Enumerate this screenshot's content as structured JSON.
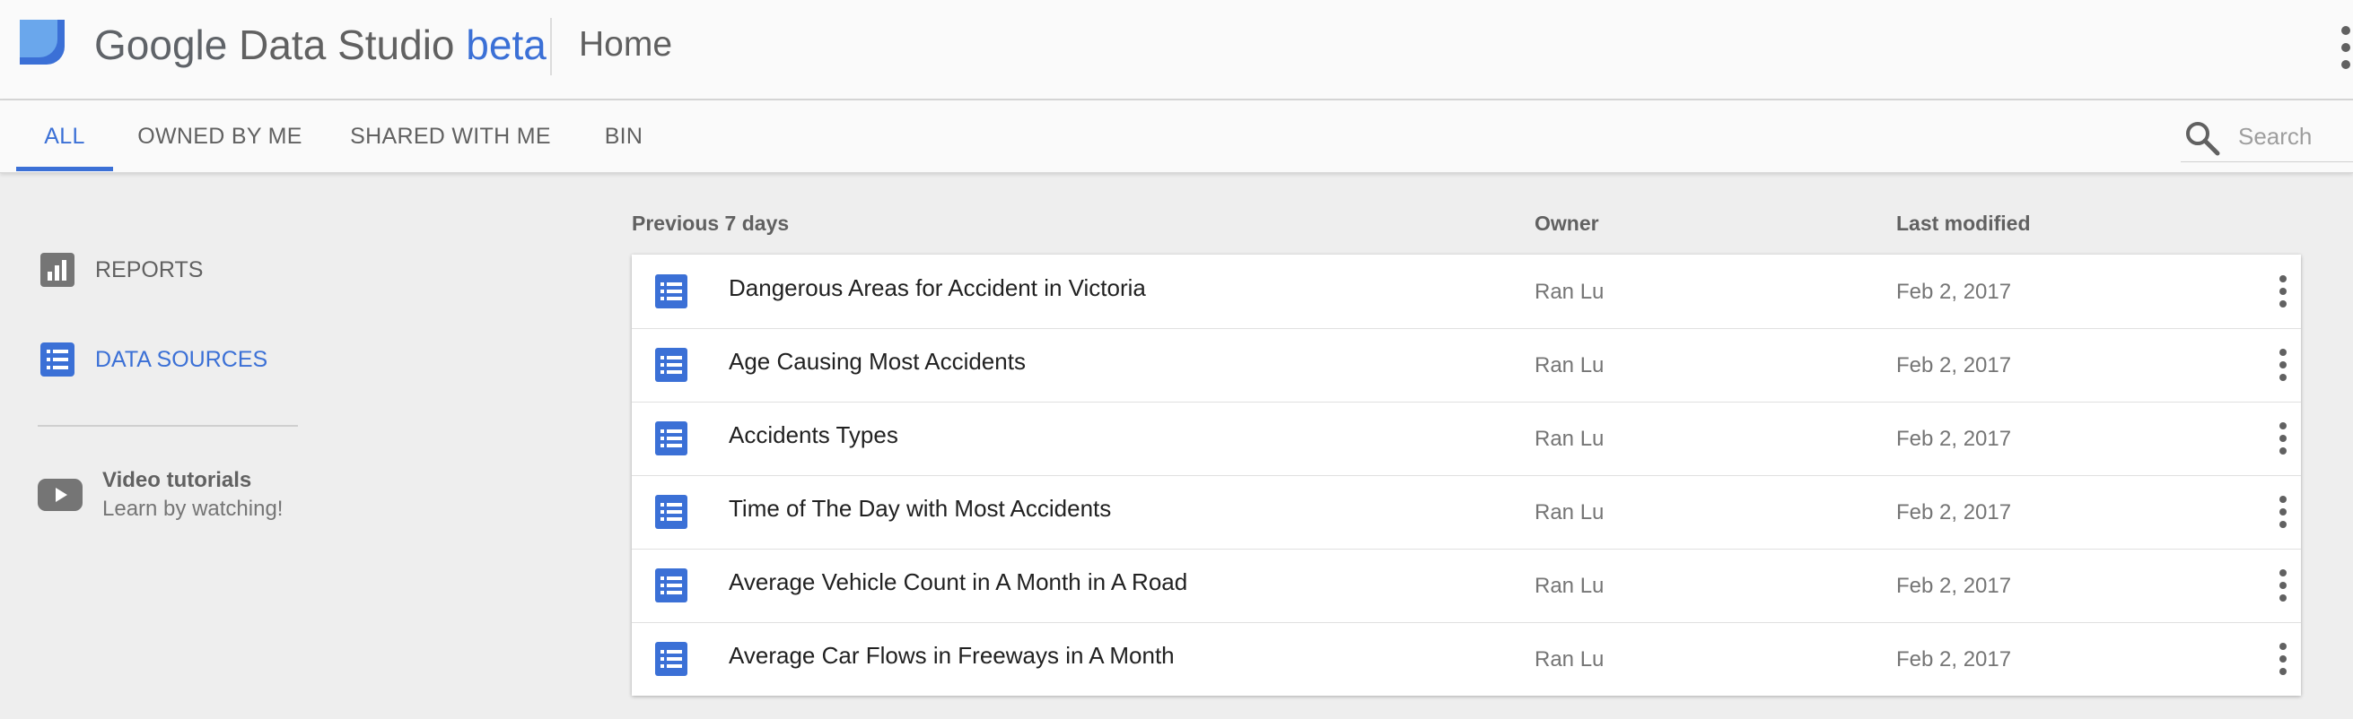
{
  "header": {
    "brand_google": "Google",
    "brand_product": "Data Studio",
    "brand_beta": "beta",
    "page_title": "Home"
  },
  "tabs": [
    {
      "label": "ALL",
      "active": true
    },
    {
      "label": "OWNED BY ME",
      "active": false
    },
    {
      "label": "SHARED WITH ME",
      "active": false
    },
    {
      "label": "BIN",
      "active": false
    }
  ],
  "search": {
    "placeholder": "Search",
    "value": ""
  },
  "sidebar": {
    "items": [
      {
        "label": "REPORTS",
        "icon": "bar-chart-icon",
        "active": false
      },
      {
        "label": "DATA SOURCES",
        "icon": "list-icon",
        "active": true
      }
    ],
    "tutorials": {
      "title": "Video tutorials",
      "subtitle": "Learn by watching!",
      "icon": "youtube-play-icon"
    }
  },
  "table": {
    "section_label": "Previous 7 days",
    "columns": {
      "owner": "Owner",
      "modified": "Last modified"
    },
    "rows": [
      {
        "name": "Dangerous Areas for Accident in Victoria",
        "owner": "Ran Lu",
        "modified": "Feb 2, 2017"
      },
      {
        "name": "Age Causing Most Accidents",
        "owner": "Ran Lu",
        "modified": "Feb 2, 2017"
      },
      {
        "name": "Accidents Types",
        "owner": "Ran Lu",
        "modified": "Feb 2, 2017"
      },
      {
        "name": "Time of The Day with Most Accidents",
        "owner": "Ran Lu",
        "modified": "Feb 2, 2017"
      },
      {
        "name": "Average Vehicle Count in A Month in A Road",
        "owner": "Ran Lu",
        "modified": "Feb 2, 2017"
      },
      {
        "name": "Average Car Flows in Freeways in A Month",
        "owner": "Ran Lu",
        "modified": "Feb 2, 2017"
      }
    ]
  },
  "colors": {
    "accent": "#3b70d6",
    "logo_light": "#6aa7ec",
    "logo_dark": "#3b70d6",
    "background": "#eeeeee"
  }
}
